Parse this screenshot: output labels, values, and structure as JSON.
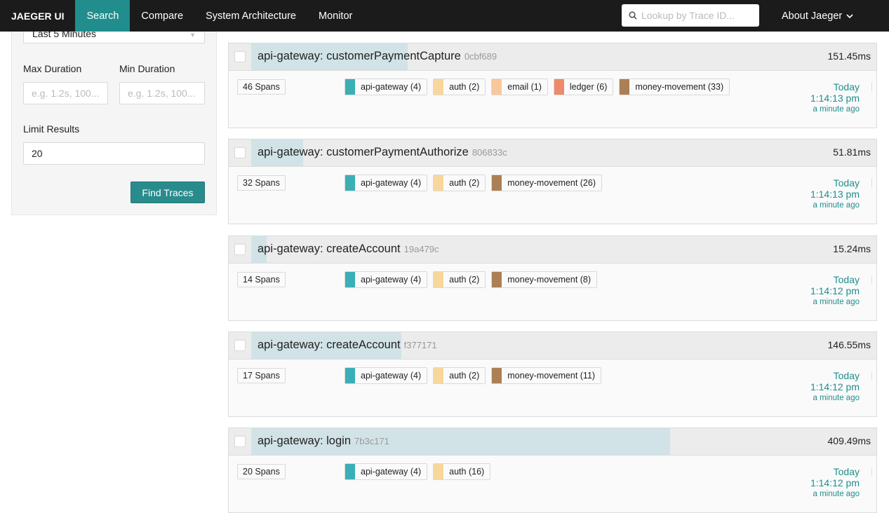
{
  "nav": {
    "brand": "JAEGER UI",
    "items": [
      "Search",
      "Compare",
      "System Architecture",
      "Monitor"
    ],
    "search_placeholder": "Lookup by Trace ID...",
    "about": "About Jaeger"
  },
  "form": {
    "lookback": "Last 5 Minutes",
    "max_duration_label": "Max Duration",
    "max_duration_placeholder": "e.g. 1.2s, 100...",
    "min_duration_label": "Min Duration",
    "min_duration_placeholder": "e.g. 1.2s, 100...",
    "limit_label": "Limit Results",
    "limit_value": "20",
    "find_button": "Find Traces"
  },
  "colors": {
    "api-gateway": "#3aafb5",
    "auth": "#f7d79c",
    "email": "#f9c89a",
    "ledger": "#ee8a6b",
    "money-movement": "#ad7f55"
  },
  "traces": [
    {
      "name": "api-gateway: customerPaymentCapture",
      "id": "0cbf689",
      "duration": "151.45ms",
      "duration_fraction": 0.25,
      "spans": "46 Spans",
      "services": [
        "api-gateway (4)",
        "auth (2)",
        "email (1)",
        "ledger (6)",
        "money-movement (33)"
      ],
      "service_keys": [
        "api-gateway",
        "auth",
        "email",
        "ledger",
        "money-movement"
      ],
      "day": "Today",
      "time": "1:14:13 pm",
      "ago": "a minute ago"
    },
    {
      "name": "api-gateway: customerPaymentAuthorize",
      "id": "806833c",
      "duration": "51.81ms",
      "duration_fraction": 0.083,
      "spans": "32 Spans",
      "services": [
        "api-gateway (4)",
        "auth (2)",
        "money-movement (26)"
      ],
      "service_keys": [
        "api-gateway",
        "auth",
        "money-movement"
      ],
      "day": "Today",
      "time": "1:14:13 pm",
      "ago": "a minute ago"
    },
    {
      "name": "api-gateway: createAccount",
      "id": "19a479c",
      "duration": "15.24ms",
      "duration_fraction": 0.025,
      "spans": "14 Spans",
      "services": [
        "api-gateway (4)",
        "auth (2)",
        "money-movement (8)"
      ],
      "service_keys": [
        "api-gateway",
        "auth",
        "money-movement"
      ],
      "day": "Today",
      "time": "1:14:12 pm",
      "ago": "a minute ago"
    },
    {
      "name": "api-gateway: createAccount",
      "id": "f377171",
      "duration": "146.55ms",
      "duration_fraction": 0.24,
      "spans": "17 Spans",
      "services": [
        "api-gateway (4)",
        "auth (2)",
        "money-movement (11)"
      ],
      "service_keys": [
        "api-gateway",
        "auth",
        "money-movement"
      ],
      "day": "Today",
      "time": "1:14:12 pm",
      "ago": "a minute ago"
    },
    {
      "name": "api-gateway: login",
      "id": "7b3c171",
      "duration": "409.49ms",
      "duration_fraction": 0.67,
      "spans": "20 Spans",
      "services": [
        "api-gateway (4)",
        "auth (16)"
      ],
      "service_keys": [
        "api-gateway",
        "auth"
      ],
      "day": "Today",
      "time": "1:14:12 pm",
      "ago": "a minute ago"
    }
  ]
}
